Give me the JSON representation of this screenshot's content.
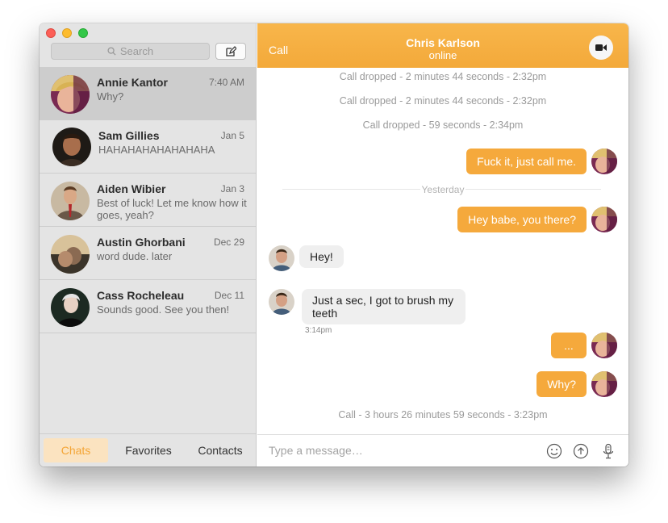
{
  "sidebar": {
    "search_placeholder": "Search",
    "contacts": [
      {
        "name": "Annie Kantor",
        "time": "7:40 AM",
        "preview": "Why?",
        "selected": true
      },
      {
        "name": "Sam Gillies",
        "time": "Jan 5",
        "preview": "HAHAHAHAHAHAHAHA",
        "selected": false
      },
      {
        "name": "Aiden Wibier",
        "time": "Jan 3",
        "preview": "Best of luck! Let me know how it goes, yeah?",
        "selected": false
      },
      {
        "name": "Austin Ghorbani",
        "time": "Dec 29",
        "preview": "word dude. later",
        "selected": false
      },
      {
        "name": "Cass Rocheleau",
        "time": "Dec 11",
        "preview": "Sounds good. See you then!",
        "selected": false
      }
    ],
    "tabs": {
      "chats": "Chats",
      "favorites": "Favorites",
      "contacts": "Contacts"
    }
  },
  "header": {
    "call_label": "Call",
    "contact_name": "Chris Karlson",
    "status": "online"
  },
  "messages": {
    "sys1": "Call dropped - 2 minutes 44 seconds - 2:32pm",
    "sys2": "Call dropped - 2 minutes 44 seconds - 2:32pm",
    "sys3": "Call dropped - 59 seconds - 2:34pm",
    "out1": "Fuck it, just call me.",
    "divider": "Yesterday",
    "out2": "Hey babe, you there?",
    "in1": "Hey!",
    "in2": "Just a sec, I got to brush my teeth",
    "in2_time": "3:14pm",
    "out3": "...",
    "out4": "Why?",
    "sys4": "Call - 3 hours 26 minutes 59 seconds - 3:23pm"
  },
  "composer": {
    "placeholder": "Type a message…"
  },
  "colors": {
    "accent": "#f5a93c",
    "sidebar_bg": "#e4e4e4",
    "selected_bg": "#cdcdcd"
  }
}
